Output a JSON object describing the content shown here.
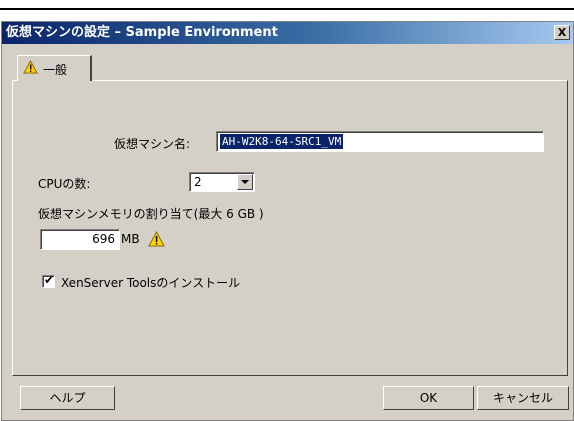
{
  "dialog": {
    "title": "仮想マシンの設定 – Sample Environment",
    "close_label": "X"
  },
  "tabs": [
    {
      "label": "一般",
      "icon": "warning-icon"
    }
  ],
  "general": {
    "vm_name_label": "仮想マシン名:",
    "vm_name_value": "AH-W2K8-64-SRC1_VM",
    "cpu_label": "CPUの数:",
    "cpu_value": "2",
    "memory_label": "仮想マシンメモリの割り当て(最大 6 GB )",
    "memory_value": "696",
    "memory_unit": "MB",
    "tools_label": "XenServer Toolsのインストール",
    "tools_checked": true
  },
  "buttons": {
    "help": "ヘルプ",
    "ok": "OK",
    "cancel": "キャンセル"
  },
  "colors": {
    "titlebar_start": "#0a246a",
    "titlebar_end": "#a6caf0",
    "dialog_face": "#d4d0c8",
    "warning_yellow": "#ffd200"
  }
}
